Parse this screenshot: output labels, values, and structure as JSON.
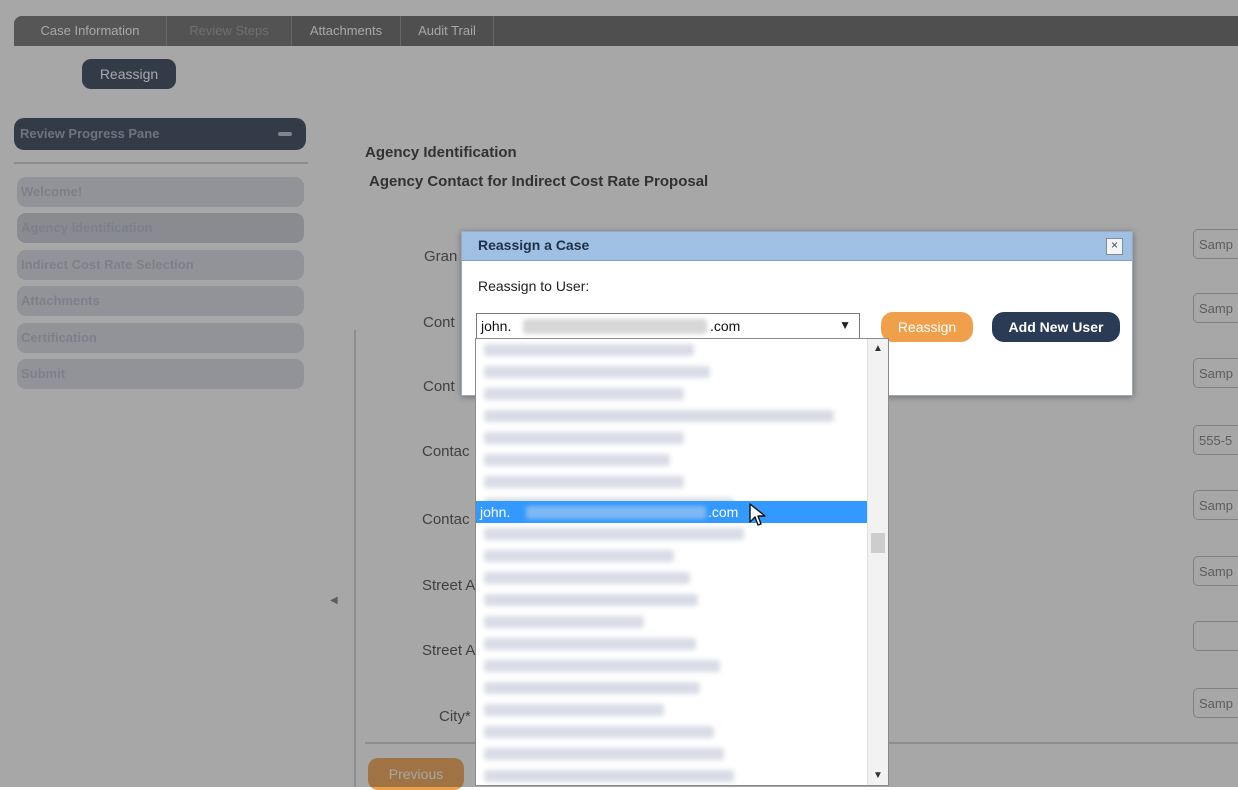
{
  "tabs": [
    {
      "label": "Case Information",
      "state": "active"
    },
    {
      "label": "Review Steps",
      "state": "disabled"
    },
    {
      "label": "Attachments",
      "state": "normal"
    },
    {
      "label": "Audit Trail",
      "state": "normal"
    }
  ],
  "header": {
    "reassign_label": "Reassign"
  },
  "left_pane": {
    "title": "Review Progress Pane",
    "items": [
      {
        "label": "Welcome!"
      },
      {
        "label": "Agency Identification"
      },
      {
        "label": "Indirect Cost Rate Selection"
      },
      {
        "label": "Attachments"
      },
      {
        "label": "Certification"
      },
      {
        "label": "Submit"
      }
    ]
  },
  "main": {
    "section_title": "Agency Identification",
    "section_subtitle": "Agency Contact for Indirect Cost Rate Proposal",
    "fields": [
      {
        "label": "Gran",
        "value": "Samp"
      },
      {
        "label": "Cont",
        "value": "Samp"
      },
      {
        "label": "Cont",
        "value": "Samp"
      },
      {
        "label": "Contac",
        "value": "555-5"
      },
      {
        "label": "Contac",
        "value": "Samp"
      },
      {
        "label": "Street A",
        "value": "Samp"
      },
      {
        "label": "Street A",
        "value": ""
      },
      {
        "label": "City*",
        "value": "Samp"
      }
    ],
    "previous_label": "Previous"
  },
  "modal": {
    "title": "Reassign a Case",
    "close_glyph": "×",
    "reassign_to_label": "Reassign to User:",
    "selected_user_prefix": "john.",
    "selected_user_suffix": ".com",
    "select_arrow": "▼",
    "reassign_button": "Reassign",
    "add_user_button": "Add New User"
  },
  "dropdown": {
    "selected_prefix": "john.",
    "selected_suffix": ".com",
    "scroll_up": "▲",
    "scroll_down": "▼"
  }
}
